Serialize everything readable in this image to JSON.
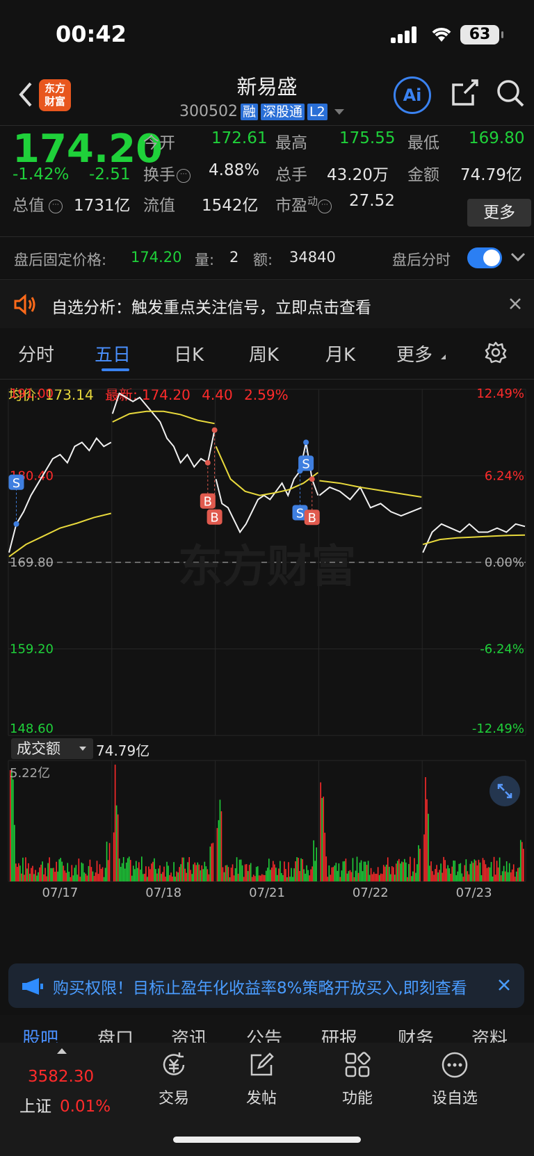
{
  "status": {
    "time": "00:42",
    "battery": "63"
  },
  "header": {
    "title": "新易盛",
    "code": "300502",
    "tags": [
      "融",
      "深股通",
      "L2"
    ],
    "logo_text": [
      "东方",
      "财富"
    ],
    "ai": "Ai"
  },
  "quote": {
    "price": "174.20",
    "change_pct": "-1.42%",
    "change": "-2.51",
    "fields": {
      "open_label": "今开",
      "open": "172.61",
      "high_label": "最高",
      "high": "175.55",
      "low_label": "最低",
      "low": "169.80",
      "turnover_label": "换手",
      "turnover": "4.88%",
      "volume_label": "总手",
      "volume": "43.20万",
      "amount_label": "金额",
      "amount": "74.79亿",
      "mktcap_label": "总值",
      "mktcap": "1731亿",
      "float_label": "流值",
      "float": "1542亿",
      "pe_label": "市盈",
      "pe_sup": "动",
      "pe": "27.52"
    },
    "more_label": "更多"
  },
  "after_hours": {
    "label": "盘后固定价格:",
    "price": "174.20",
    "vol_label": "量:",
    "vol": "2",
    "amt_label": "额:",
    "amt": "34840",
    "switch_label": "盘后分时"
  },
  "alert": {
    "text": "自选分析：触发重点关注信号，立即点击查看"
  },
  "tabs": [
    "分时",
    "五日",
    "日K",
    "周K",
    "月K",
    "更多",
    ""
  ],
  "chart_data": {
    "type": "line",
    "legend": {
      "avg_label": "均价:",
      "avg": "173.14",
      "latest_label": "最新:",
      "latest": "174.20",
      "chg": "4.40",
      "chg_pct": "2.59%"
    },
    "y_left": [
      "191.00",
      "180.40",
      "169.80",
      "159.20",
      "148.60"
    ],
    "y_right": [
      "12.49%",
      "6.24%",
      "0.00%",
      "-6.24%",
      "-12.49%"
    ],
    "ylim": [
      148.6,
      191.0
    ],
    "prev_close": 169.8,
    "days": [
      "07/17",
      "07/18",
      "07/21",
      "07/22",
      "07/23"
    ],
    "price": [
      [
        171.0,
        174.5,
        176.0,
        178.0,
        179.5,
        181.0,
        182.5,
        183.0,
        182.0,
        184.0,
        184.5,
        183.5,
        185.0,
        184.0,
        184.5
      ],
      [
        188.0,
        190.5,
        190.0,
        189.5,
        190.0,
        189.0,
        188.0,
        187.0,
        185.0,
        184.0,
        182.0,
        183.0,
        181.5,
        182.5,
        182.0,
        186.0
      ],
      [
        180.0,
        177.0,
        176.5,
        175.0,
        173.5,
        174.5,
        176.0,
        177.5,
        178.0,
        177.5,
        178.5,
        179.5,
        178.0,
        180.0,
        181.0,
        184.5,
        180.0,
        178.0
      ],
      [
        178.0,
        179.0,
        178.5,
        177.5,
        179.0,
        176.5,
        177.0,
        176.0,
        175.5,
        176.0,
        176.5
      ],
      [
        171.0,
        173.5,
        174.5,
        174.0,
        173.5,
        174.5,
        173.5,
        173.5,
        174.0,
        173.5,
        174.5,
        174.2
      ]
    ],
    "avg": [
      [
        170.5,
        172.0,
        173.0,
        174.0,
        174.6,
        175.3,
        175.8
      ],
      [
        187.0,
        188.0,
        188.3,
        188.3,
        187.9,
        187.2,
        186.8
      ],
      [
        184.0,
        180.0,
        178.5,
        178.0,
        178.3,
        178.7,
        179.5,
        180.8
      ],
      [
        179.8,
        179.5,
        179.0,
        178.6,
        178.2,
        177.8
      ],
      [
        172.0,
        172.6,
        172.8,
        172.9,
        173.0,
        173.1,
        173.14
      ]
    ],
    "signals": [
      {
        "text": "S"
      },
      {
        "text": "B"
      },
      {
        "text": "B"
      },
      {
        "text": "S"
      },
      {
        "text": "S"
      },
      {
        "text": "B"
      }
    ],
    "watermark": "东方财富",
    "volume": {
      "selector": "成交额",
      "total": "74.79亿",
      "max_label": "5.22亿"
    }
  },
  "banner": {
    "text": "购买权限！目标止盈年化收益率8%策略开放买入,即刻查看"
  },
  "bottom_tabs": [
    "股吧",
    "盘口",
    "资讯",
    "公告",
    "研报",
    "财务",
    "资料"
  ],
  "nav": {
    "index_value": "3582.30",
    "index_name": "上证",
    "index_pct": "0.01%",
    "items": [
      "交易",
      "发帖",
      "功能",
      "设自选"
    ]
  }
}
